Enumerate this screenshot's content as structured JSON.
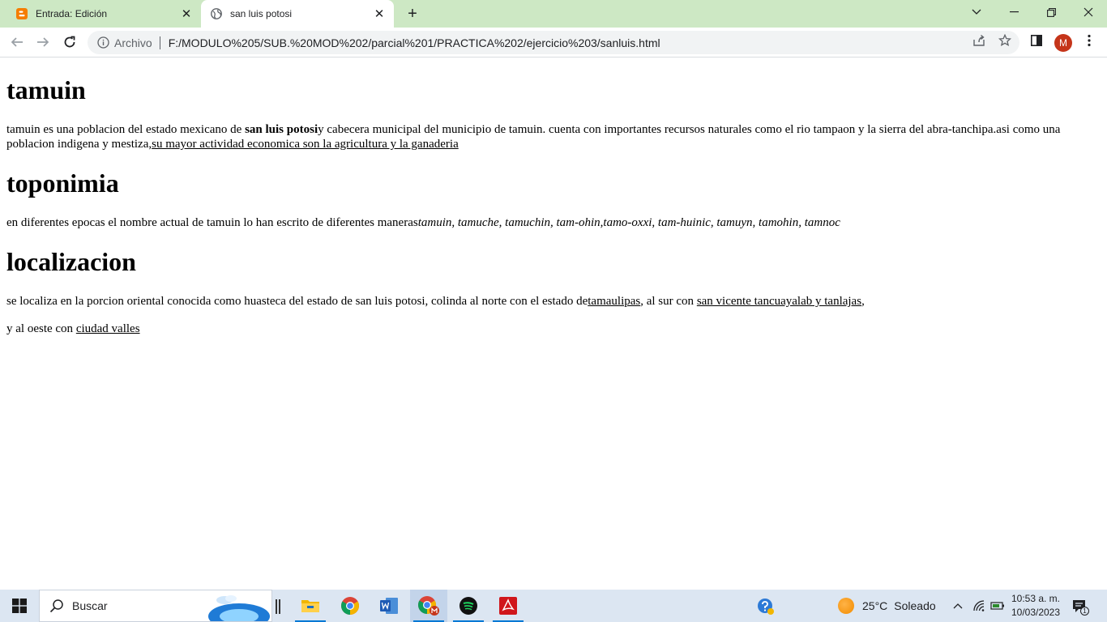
{
  "browser": {
    "tabs": [
      {
        "title": "Entrada: Edición",
        "icon": "blogger-icon",
        "active": false
      },
      {
        "title": "san luis potosi",
        "icon": "globe-icon",
        "active": true
      }
    ],
    "omnibox": {
      "security_chip": "Archivo",
      "url": "F:/MODULO%205/SUB.%20MOD%202/parcial%201/PRACTICA%202/ejercicio%203/sanluis.html"
    },
    "profile_initial": "M"
  },
  "page": {
    "sections": [
      {
        "heading": "tamuin",
        "p_start": "tamuin es una poblacion del estado mexicano de ",
        "p_bold": "san luis potosi",
        "p_mid": "y cabecera municipal del municipio de tamuin. cuenta con importantes recursos naturales como el rio tampaon y la sierra del abra-tanchipa.asi como una poblacion indigena y mestiza,",
        "p_link": "su mayor actividad economica son la agricultura y la ganaderia"
      },
      {
        "heading": "toponimia",
        "p_start": "en diferentes epocas el nombre actual de tamuin lo han escrito de diferentes maneras",
        "p_italic": "tamuin, tamuche, tamuchin, tam-ohin,tamo-oxxi, tam-huinic, tamuyn, tamohin, tamnoc"
      },
      {
        "heading": "localizacion",
        "p1_start": "se localiza en la porcion oriental conocida como huasteca del estado de san luis potosi, colinda al norte con el estado de",
        "p1_link1": "tamaulipas",
        "p1_mid": ", al sur con ",
        "p1_link2": "san vicente tancuayalab y tanlajas",
        "p1_end": ",",
        "p2_start": "y al oeste con ",
        "p2_link": "ciudad valles"
      }
    ]
  },
  "taskbar": {
    "search_placeholder": "Buscar",
    "apps": [
      "file-explorer-icon",
      "chrome-icon",
      "word-icon",
      "chrome-profile-icon",
      "spotify-icon",
      "acrobat-icon"
    ],
    "weather": {
      "temp": "25°C",
      "condition": "Soleado"
    },
    "clock": {
      "time": "10:53 a. m.",
      "date": "10/03/2023"
    },
    "notification_count": "1"
  }
}
